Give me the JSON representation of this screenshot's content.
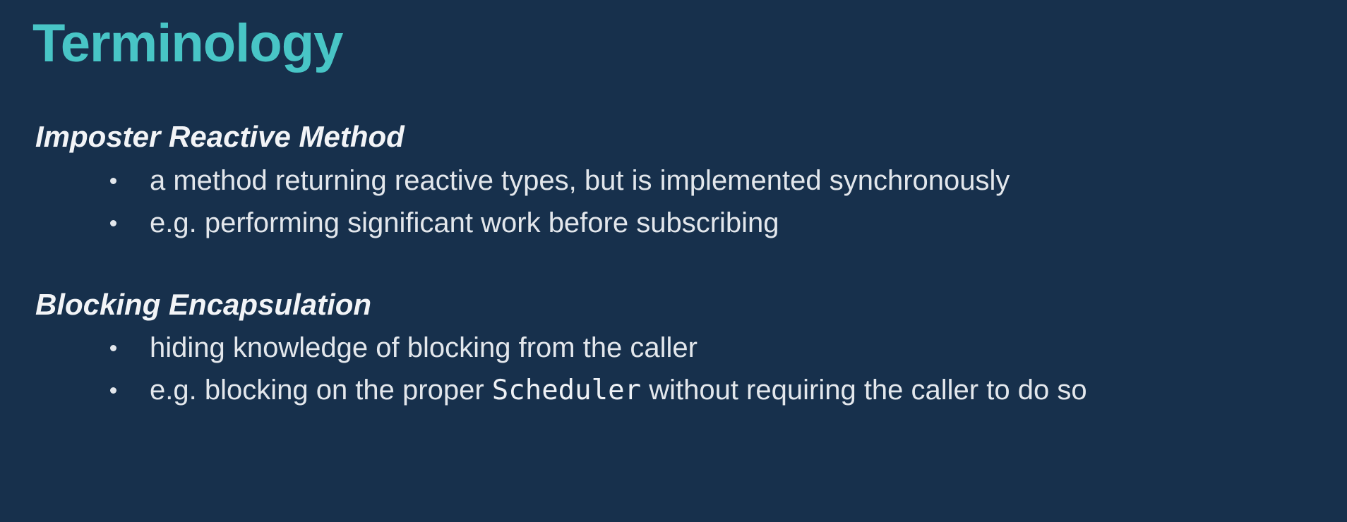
{
  "slide": {
    "title": "Terminology",
    "sections": [
      {
        "term": "Imposter Reactive Method",
        "bullets": [
          {
            "text": "a method returning reactive types, but is implemented synchronously"
          },
          {
            "text": "e.g. performing significant work before subscribing"
          }
        ]
      },
      {
        "term": "Blocking Encapsulation",
        "bullets": [
          {
            "text": "hiding knowledge of blocking from the caller"
          },
          {
            "prefix": "e.g. blocking on the proper ",
            "code": "Scheduler",
            "suffix": " without requiring the caller to do so"
          }
        ]
      }
    ]
  },
  "colors": {
    "background": "#17304c",
    "title": "#48c5c6",
    "text": "#e3e7ec"
  }
}
